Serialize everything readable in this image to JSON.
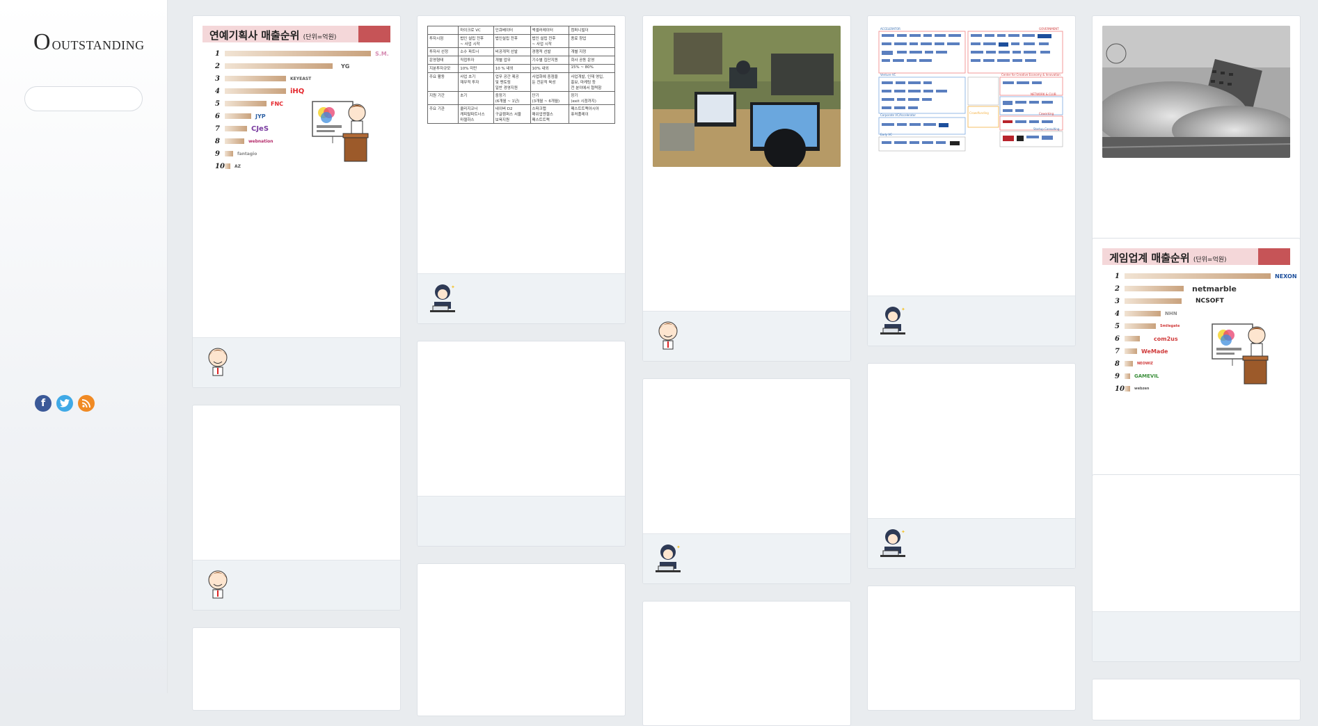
{
  "sidebar": {
    "logo_mark": "O",
    "logo_text": "OUTSTANDING",
    "search_placeholder": "",
    "social": [
      "facebook-icon",
      "twitter-icon",
      "rss-icon"
    ]
  },
  "cards": {
    "entertainment_chart": {
      "title": "연예기획사 매출순위",
      "unit": "(단위=억원)",
      "ranks": [
        "1",
        "2",
        "3",
        "4",
        "5",
        "6",
        "7",
        "8",
        "9",
        "10"
      ],
      "logos": [
        "S.M.",
        "YG",
        "KEYEAST",
        "iHQ",
        "FNC",
        "JYP",
        "CJeS",
        "webnation",
        "fantagio",
        "AZ"
      ]
    },
    "game_chart": {
      "title": "게임업계 매출순위",
      "unit": "(단위=억원)",
      "ranks": [
        "1",
        "2",
        "3",
        "4",
        "5",
        "6",
        "7",
        "8",
        "9",
        "10"
      ],
      "logos": [
        "NEXON",
        "netmarble",
        "NCSOFT",
        "NHN",
        "Smilegate",
        "com2us",
        "WeMade",
        "NEOWIZ",
        "GAMEVIL",
        "webzen"
      ]
    },
    "vc_table": {
      "rows": [
        [
          "",
          "마이크로 VC",
          "인큐베이터",
          "액셀러레이터",
          "컴퍼니빌더"
        ],
        [
          "투자시점",
          "법인 설립 전후\n~ 사업 시작",
          "법인설립 전후",
          "법인 설립 전후\n~ 사업 시작",
          "종료 창업"
        ],
        [
          "투자사 선정",
          "소수 파트너",
          "비공개적 선발",
          "경쟁적 선발",
          "개별 지정"
        ],
        [
          "운영형태",
          "직접투자",
          "개별 업무",
          "기수별 집단지원",
          "회사 공동 운영"
        ],
        [
          "지분투자규모",
          "10% 미만",
          "10 % 내외",
          "10% 내외",
          "15% ~ 80%"
        ],
        [
          "주요 활동",
          "사업 초기\n재무적 투자",
          "업무 공간 제공\n및 멘토링\n일반 경영지원",
          "사업화에 중점을\n둔 전문적 육성",
          "사업개발, 인재 영입,\n홍보, 마케팅 등\n전 분야에서 협력함"
        ],
        [
          "지원 기간",
          "초기",
          "중장기\n(6개월 ~ 1년)",
          "단기\n(3개월 ~ 6개월)",
          "장기\n(exit 시점까지)"
        ],
        [
          "주요 기관",
          "쿨리지코너\n캐피탈파트너스\n마젤하스",
          "네이버 D2\n구글캠퍼스 서울\n보육지원",
          "스파크랩\n매쉬업엔젤스\n패스트트랙",
          "패스트트랙아시아\n퓨처플레이"
        ]
      ]
    },
    "map_groups": [
      "ACCELERATOR",
      "GOVERNMENT",
      "Venture VC",
      "Center for Creative Economy & Innovation",
      "Corporate VC/Accelerator",
      "NETWORK & CLUB",
      "Crowdfunding",
      "Startup Consulting",
      "Coworking",
      "Early VC"
    ]
  }
}
